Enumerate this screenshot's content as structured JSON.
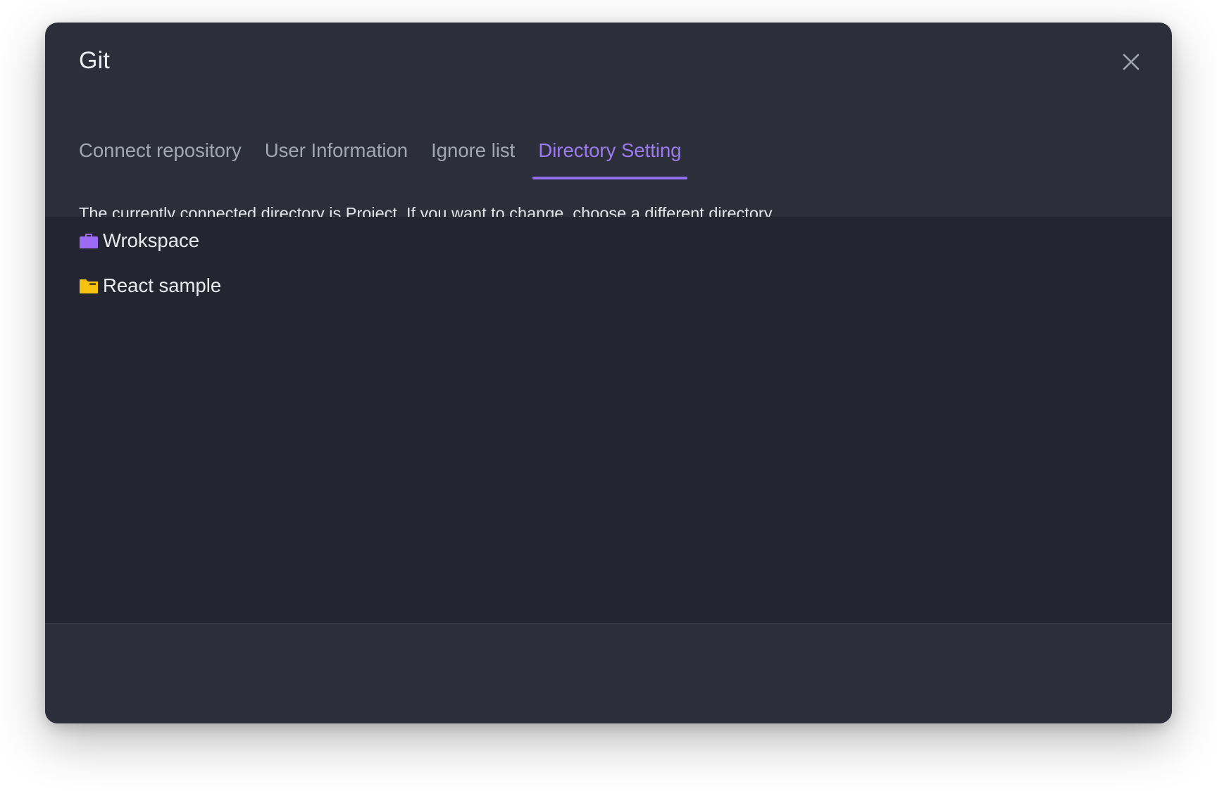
{
  "dialog": {
    "title": "Git",
    "close_icon": "close-icon"
  },
  "tabs": [
    {
      "label": "Connect repository",
      "active": false
    },
    {
      "label": "User Information",
      "active": false
    },
    {
      "label": "Ignore list",
      "active": false
    },
    {
      "label": "Directory Setting",
      "active": true
    }
  ],
  "description": "The currently connected directory is Project. If you want to change, choose a different directory.",
  "directory_tree": [
    {
      "label": "Wrokspace",
      "icon": "briefcase-icon",
      "icon_color": "#9b6cf3"
    },
    {
      "label": "React sample",
      "icon": "folder-icon",
      "icon_color": "#f5c211"
    }
  ],
  "colors": {
    "accent": "#8f6df0",
    "dialog_bg": "#2c2f39",
    "tree_bg": "#232630"
  }
}
